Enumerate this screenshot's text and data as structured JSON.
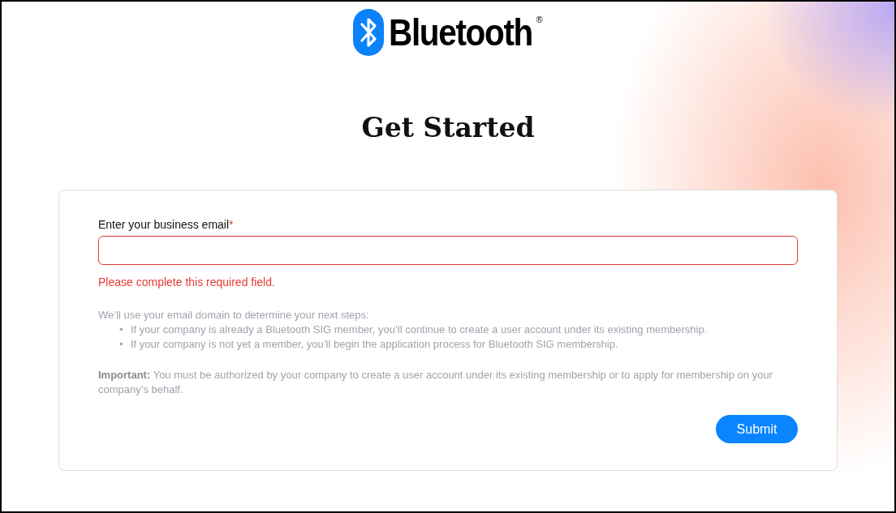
{
  "logo": {
    "wordmark": "Bluetooth",
    "registered": "®"
  },
  "heading": "Get Started",
  "form": {
    "label": "Enter your business email",
    "required_mark": "*",
    "invalid": true,
    "error": "Please complete this required field.",
    "intro": "We’ll use your email domain to determine your next steps:",
    "bullet_marker": "•",
    "bullets": [
      "If your company is already a Bluetooth SIG member, you’ll continue to create a user account under its existing membership.",
      "If your company is not yet a member, you’ll begin the application process for Bluetooth SIG membership."
    ],
    "note": "**Important:** You must be authorized by your company to create a user account under its existing membership or to apply for membership on your company’s behalf.",
    "submit": "Submit"
  }
}
